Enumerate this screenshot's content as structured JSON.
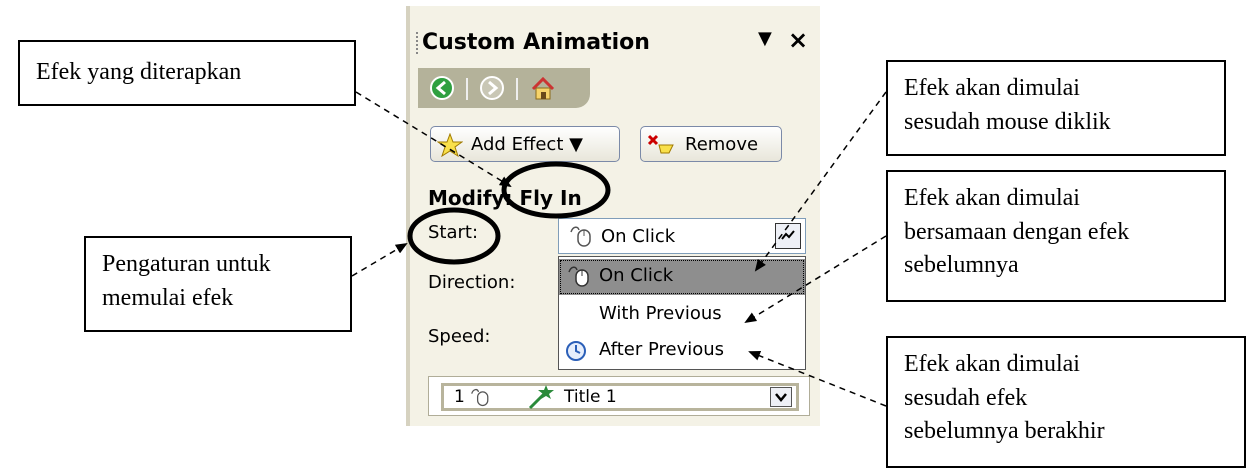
{
  "pane": {
    "title": "Custom Animation",
    "menu_glyph": "▼",
    "close_glyph": "×",
    "add_effect_label": "Add Effect ▼",
    "remove_label": "Remove",
    "modify_label": "Modify: Fly In",
    "start_label": "Start:",
    "direction_label": "Direction:",
    "speed_label": "Speed:",
    "start_value": "On Click",
    "start_options": [
      "On Click",
      "With Previous",
      "After Previous"
    ],
    "list_item": {
      "number": "1",
      "label": "Title 1"
    }
  },
  "callouts": {
    "applied_effect": "Efek yang diterapkan",
    "start_setting": [
      "Pengaturan untuk",
      "memulai efek"
    ],
    "on_click": [
      "Efek akan dimulai",
      "sesudah mouse diklik"
    ],
    "with_previous": [
      "Efek akan dimulai",
      "bersamaan dengan efek",
      "sebelumnya"
    ],
    "after_previous": [
      "Efek akan dimulai",
      "sesudah efek",
      "sebelumnya berakhir"
    ]
  },
  "colors": {
    "pane_bg": "#f4f2e6",
    "nav_bg": "#b4b29a",
    "selected_item": "#8e8e8e"
  }
}
